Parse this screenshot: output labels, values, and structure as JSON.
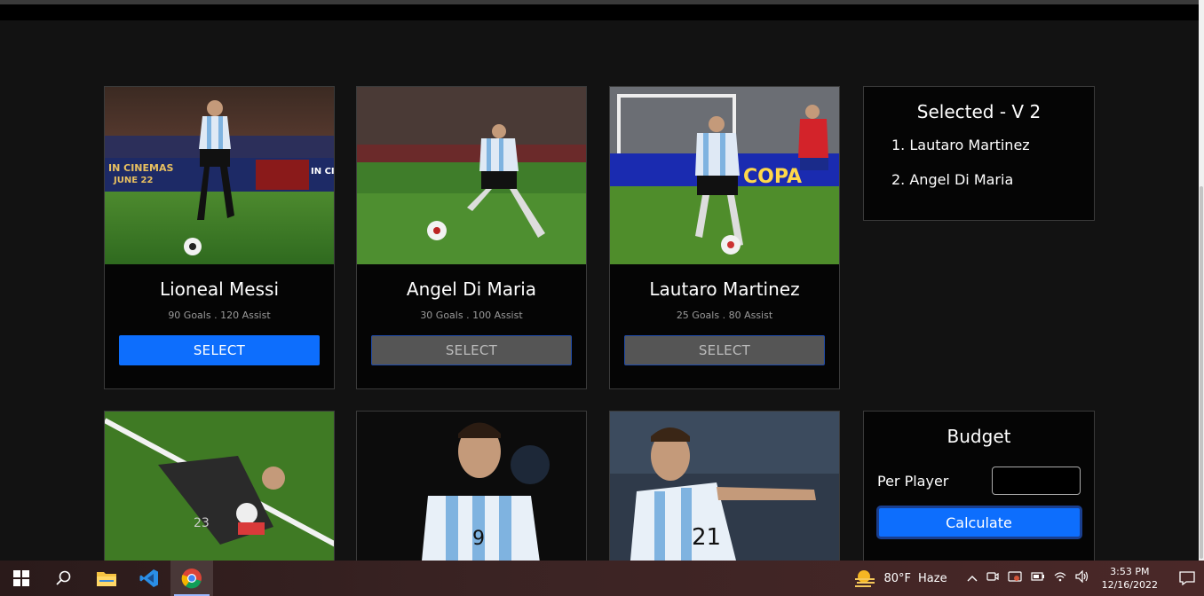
{
  "cards": [
    {
      "name": "Lioneal Messi",
      "stats": "90 Goals . 120 Assist",
      "button": "SELECT",
      "state": "active"
    },
    {
      "name": "Angel Di Maria",
      "stats": "30 Goals . 100 Assist",
      "button": "SELECT",
      "state": "disabled"
    },
    {
      "name": "Lautaro Martinez",
      "stats": "25 Goals . 80 Assist",
      "button": "SELECT",
      "state": "disabled"
    }
  ],
  "bottom_cards": [
    {
      "jersey": "23"
    },
    {
      "jersey": "9"
    },
    {
      "jersey": "21"
    }
  ],
  "selected": {
    "title": "Selected - V 2",
    "items": [
      "1. Lautaro Martinez",
      "2. Angel Di Maria"
    ]
  },
  "budget": {
    "title": "Budget",
    "per_player_label": "Per Player",
    "input_value": "",
    "calculate_label": "Calculate"
  },
  "taskbar": {
    "weather_temp": "80°F",
    "weather_desc": "Haze",
    "time": "3:53 PM",
    "date": "12/16/2022"
  },
  "colors": {
    "accent": "#0d6efd",
    "disabled": "#555555",
    "background": "#121212",
    "card": "#050505"
  }
}
